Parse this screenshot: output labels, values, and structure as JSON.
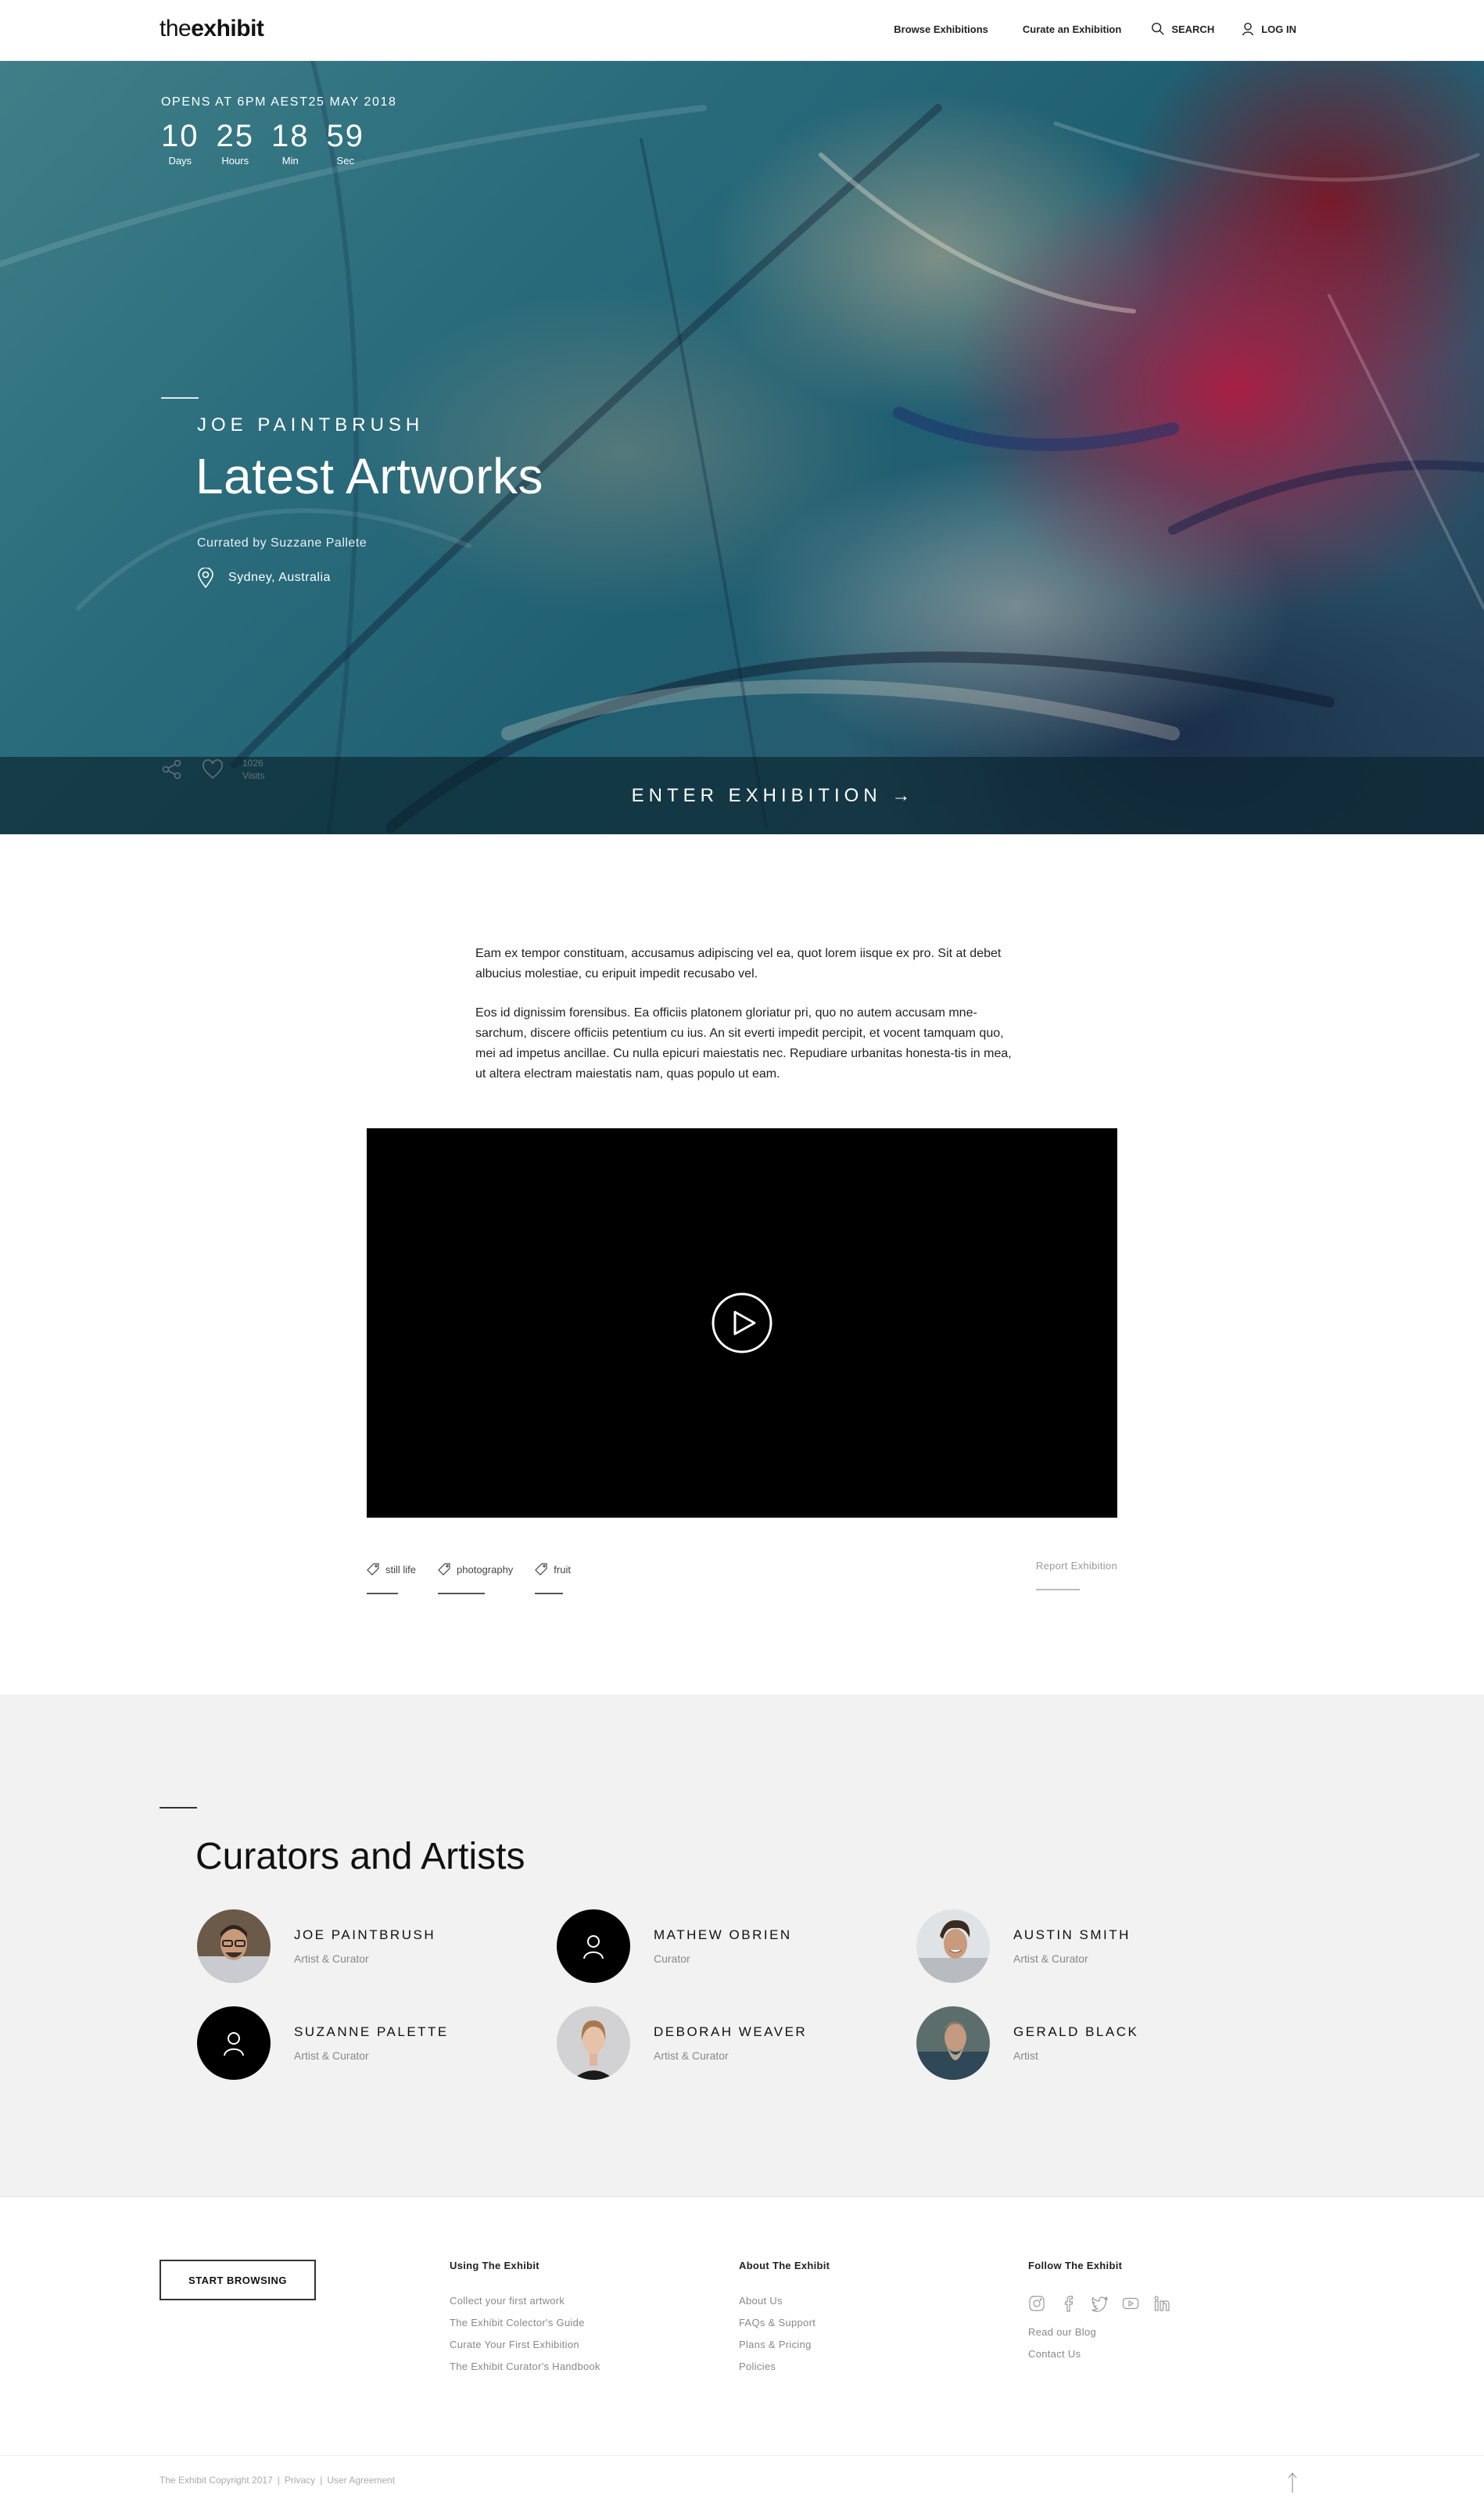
{
  "header": {
    "logo_light": "the",
    "logo_bold": "exhibit",
    "nav": {
      "browse": "Browse Exhibitions",
      "curate": "Curate an Exhibition",
      "search": "SEARCH",
      "login": "LOG IN"
    }
  },
  "hero": {
    "opens_label": "OPENS AT 6PM AEST25 MAY 2018",
    "countdown": [
      {
        "value": "10",
        "label": "Days"
      },
      {
        "value": "25",
        "label": "Hours"
      },
      {
        "value": "18",
        "label": "Min"
      },
      {
        "value": "59",
        "label": "Sec"
      }
    ],
    "artist": "JOE PAINTBRUSH",
    "title": "Latest Artworks",
    "curated_by": "Currated by Suzzane Pallete",
    "location": "Sydney, Australia",
    "visits_count": "1026",
    "visits_label": "Visits",
    "enter_label": "ENTER EXHIBITION →"
  },
  "description": {
    "paragraphs": [
      "Eam ex tempor constituam, accusamus adipiscing vel ea, quot lorem iisque ex pro. Sit at debet albucius molestiae, cu eripuit impedit recusabo vel.",
      "Eos id dignissim forensibus. Ea officiis platonem gloriatur pri, quo no autem accusam mne-sarchum, discere officiis petentium cu ius. An sit everti impedit percipit, et vocent tamquam quo, mei ad impetus ancillae. Cu nulla epicuri maiestatis nec. Repudiare urbanitas honesta-tis in mea, ut altera electram maiestatis nam, quas populo ut eam."
    ]
  },
  "tags": [
    "still life",
    "photography",
    "fruit"
  ],
  "report_label": "Report Exhibition",
  "curators": {
    "title": "Curators and Artists",
    "people": [
      {
        "name": "JOE PAINTBRUSH",
        "role": "Artist & Curator",
        "avatar": "photo"
      },
      {
        "name": "MATHEW OBRIEN",
        "role": "Curator",
        "avatar": "placeholder"
      },
      {
        "name": "AUSTIN SMITH",
        "role": "Artist & Curator",
        "avatar": "photo"
      },
      {
        "name": "SUZANNE PALETTE",
        "role": "Artist & Curator",
        "avatar": "placeholder"
      },
      {
        "name": "DEBORAH WEAVER",
        "role": "Artist & Curator",
        "avatar": "photo"
      },
      {
        "name": "GERALD BLACK",
        "role": "Artist",
        "avatar": "photo"
      }
    ]
  },
  "footer": {
    "start_browsing": "START BROWSING",
    "columns": [
      {
        "title": "Using The Exhibit",
        "links": [
          "Collect your first artwork",
          "The Exhibit Colector's Guide",
          "Curate Your First Exhibition",
          "The Exhibit Curator's Handbook"
        ]
      },
      {
        "title": "About The Exhibit",
        "links": [
          "About Us",
          "FAQs & Support",
          "Plans & Pricing",
          "Policies"
        ]
      },
      {
        "title": "Follow The Exhibit",
        "links": [
          "Read our Blog",
          "Contact Us"
        ]
      }
    ],
    "socials": [
      "instagram-icon",
      "facebook-icon",
      "twitter-icon",
      "youtube-icon",
      "linkedin-icon"
    ],
    "copyright": "The Exhibit Copyright 2017",
    "privacy": "Privacy",
    "agreement": "User Agreement",
    "separator": "|"
  }
}
